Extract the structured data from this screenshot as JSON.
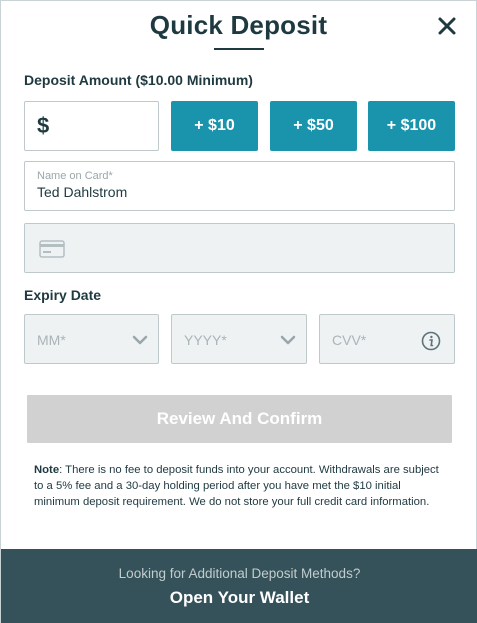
{
  "modal": {
    "title": "Quick Deposit"
  },
  "deposit": {
    "amount_label": "Deposit Amount ($10.00 Minimum)",
    "currency_symbol": "$",
    "amount_value": "",
    "quick_amounts": [
      "+ $10",
      "+ $50",
      "+ $100"
    ]
  },
  "card": {
    "name_label": "Name on Card*",
    "name_value": "Ted Dahlstrom",
    "number_value": ""
  },
  "expiry": {
    "label": "Expiry Date",
    "month_placeholder": "MM*",
    "year_placeholder": "YYYY*",
    "cvv_placeholder": "CVV*"
  },
  "actions": {
    "review_label": "Review And Confirm"
  },
  "note": {
    "lead": "Note",
    "text": ": There is no fee to deposit funds into your account. Withdrawals are subject to a 5% fee and a 30-day holding period after you have met the $10 initial minimum deposit requirement. We do not store your full credit card information."
  },
  "footer": {
    "question": "Looking for Additional Deposit Methods?",
    "link_label": "Open Your Wallet"
  },
  "colors": {
    "accent": "#1a93ad",
    "heading": "#1e3940",
    "footer_bg": "#35525a",
    "disabled_button": "#d1d1d1",
    "field_disabled_bg": "#eff2f3"
  },
  "icons": {
    "close": "close-icon",
    "card": "credit-card-icon",
    "chevron": "chevron-down-icon",
    "info": "info-icon"
  }
}
